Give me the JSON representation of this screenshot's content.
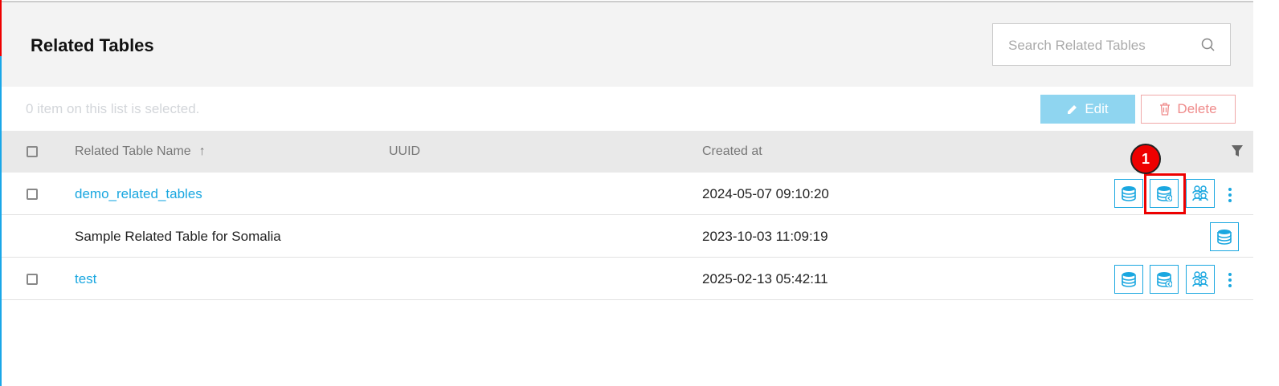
{
  "header": {
    "title": "Related Tables",
    "search_placeholder": "Search Related Tables"
  },
  "toolbar": {
    "selection_text": "0 item on this list is selected.",
    "edit_label": "Edit",
    "delete_label": "Delete"
  },
  "table": {
    "columns": [
      "Related Table Name",
      "UUID",
      "Created at"
    ],
    "rows": [
      {
        "name": "demo_related_tables",
        "uuid": "",
        "created": "2024-05-07 09:10:20",
        "selectable": true
      },
      {
        "name": "Sample Related Table for Somalia",
        "uuid": "",
        "created": "2023-10-03 11:09:19",
        "selectable": false
      },
      {
        "name": "test",
        "uuid": "",
        "created": "2025-02-13 05:42:11",
        "selectable": true
      }
    ]
  },
  "annotation": {
    "label": "1"
  },
  "colors": {
    "accent": "#1aa7e0",
    "danger": "#e00"
  }
}
